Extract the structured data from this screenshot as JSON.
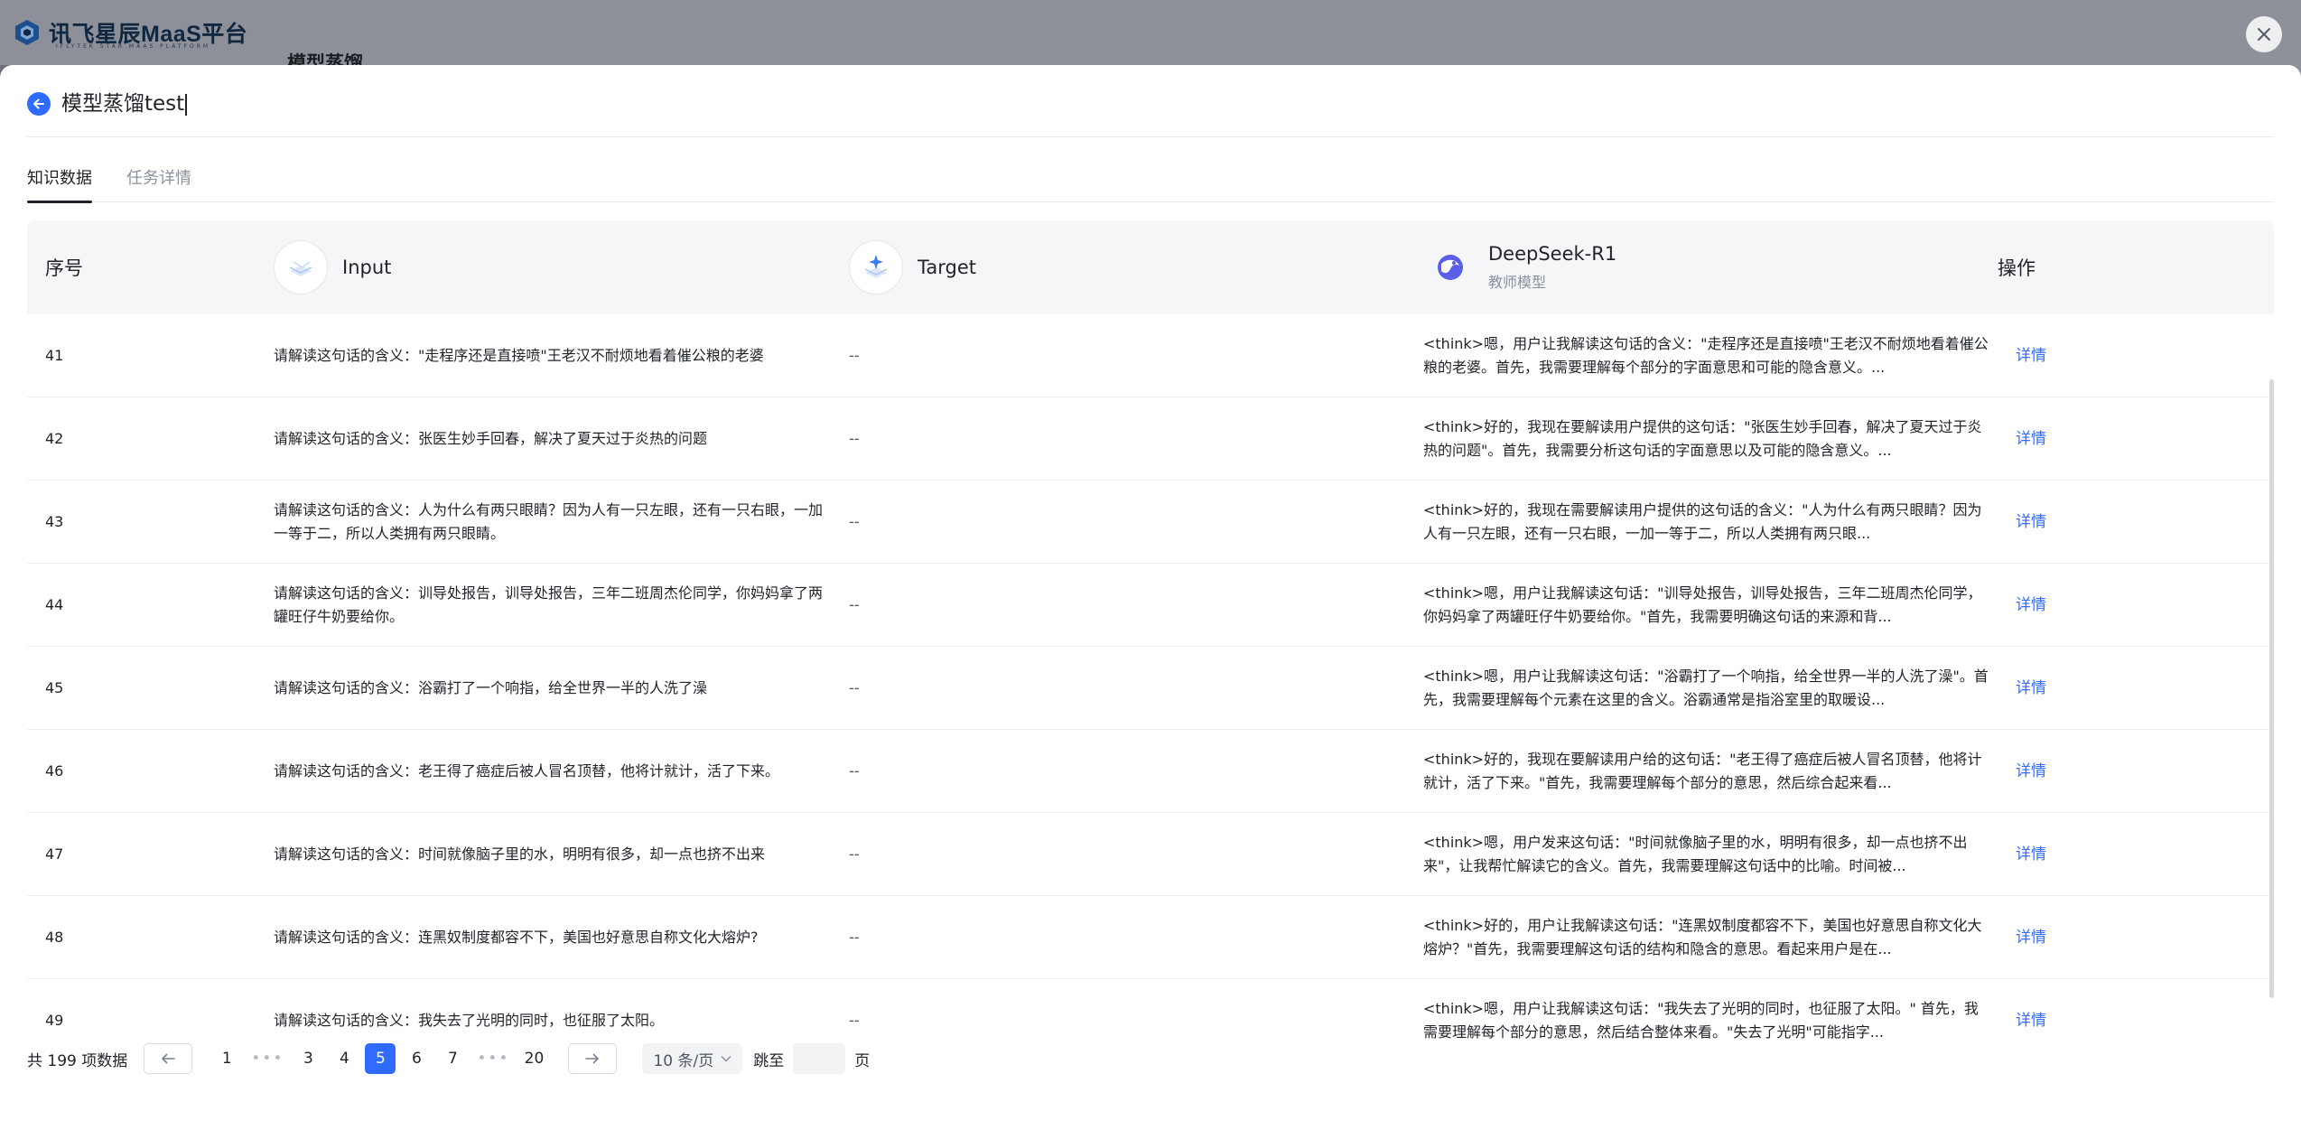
{
  "app": {
    "logo_text": "讯飞星辰MaaS平台",
    "logo_sub": "IFLYTEK STAR MAAS PLATFORM",
    "bg_page_title": "模型蒸馏"
  },
  "drawer": {
    "title": "模型蒸馏test",
    "tabs": [
      {
        "label": "知识数据",
        "active": true
      },
      {
        "label": "任务详情",
        "active": false
      }
    ]
  },
  "table": {
    "headers": {
      "no": "序号",
      "input": "Input",
      "target": "Target",
      "teacher_name": "DeepSeek-R1",
      "teacher_sub": "教师模型",
      "op": "操作"
    },
    "action_label": "详情",
    "rows": [
      {
        "no": "41",
        "input": "请解读这句话的含义：\"走程序还是直接喷\"王老汉不耐烦地看着催公粮的老婆",
        "target": "--",
        "output": "<think>嗯，用户让我解读这句话的含义：\"走程序还是直接喷\"王老汉不耐烦地看着催公粮的老婆。首先，我需要理解每个部分的字面意思和可能的隐含意义。..."
      },
      {
        "no": "42",
        "input": "请解读这句话的含义：张医生妙手回春，解决了夏天过于炎热的问题",
        "target": "--",
        "output": "<think>好的，我现在要解读用户提供的这句话：\"张医生妙手回春，解决了夏天过于炎热的问题\"。首先，我需要分析这句话的字面意思以及可能的隐含意义。..."
      },
      {
        "no": "43",
        "input": "请解读这句话的含义：人为什么有两只眼睛？因为人有一只左眼，还有一只右眼，一加一等于二，所以人类拥有两只眼睛。",
        "target": "--",
        "output": "<think>好的，我现在需要解读用户提供的这句话的含义：\"人为什么有两只眼睛？因为人有一只左眼，还有一只右眼，一加一等于二，所以人类拥有两只眼..."
      },
      {
        "no": "44",
        "input": "请解读这句话的含义：训导处报告，训导处报告，三年二班周杰伦同学，你妈妈拿了两罐旺仔牛奶要给你。",
        "target": "--",
        "output": "<think>嗯，用户让我解读这句话：\"训导处报告，训导处报告，三年二班周杰伦同学，你妈妈拿了两罐旺仔牛奶要给你。\"首先，我需要明确这句话的来源和背..."
      },
      {
        "no": "45",
        "input": "请解读这句话的含义：浴霸打了一个响指，给全世界一半的人洗了澡",
        "target": "--",
        "output": "<think>嗯，用户让我解读这句话：\"浴霸打了一个响指，给全世界一半的人洗了澡\"。首先，我需要理解每个元素在这里的含义。浴霸通常是指浴室里的取暖设..."
      },
      {
        "no": "46",
        "input": "请解读这句话的含义：老王得了癌症后被人冒名顶替，他将计就计，活了下来。",
        "target": "--",
        "output": "<think>好的，我现在要解读用户给的这句话：\"老王得了癌症后被人冒名顶替，他将计就计，活了下来。\"首先，我需要理解每个部分的意思，然后综合起来看..."
      },
      {
        "no": "47",
        "input": "请解读这句话的含义：时间就像脑子里的水，明明有很多，却一点也挤不出来",
        "target": "--",
        "output": "<think>嗯，用户发来这句话：\"时间就像脑子里的水，明明有很多，却一点也挤不出来\"，让我帮忙解读它的含义。首先，我需要理解这句话中的比喻。时间被..."
      },
      {
        "no": "48",
        "input": "请解读这句话的含义：连黑奴制度都容不下，美国也好意思自称文化大熔炉?",
        "target": "--",
        "output": "<think>好的，用户让我解读这句话：\"连黑奴制度都容不下，美国也好意思自称文化大熔炉？\"首先，我需要理解这句话的结构和隐含的意思。看起来用户是在..."
      },
      {
        "no": "49",
        "input": "请解读这句话的含义：我失去了光明的同时，也征服了太阳。",
        "target": "--",
        "output": "<think>嗯，用户让我解读这句话：\"我失去了光明的同时，也征服了太阳。\" 首先，我需要理解每个部分的意思，然后结合整体来看。\"失去了光明\"可能指字..."
      }
    ]
  },
  "pagination": {
    "total_text": "共 199 项数据",
    "pages": [
      "1",
      "3",
      "4",
      "5",
      "6",
      "7",
      "20"
    ],
    "current": "5",
    "ellipsis": "•••",
    "page_size": "10 条/页",
    "jump_label": "跳至",
    "jump_value": "",
    "page_suffix": "页"
  },
  "colors": {
    "accent": "#2f6bff",
    "link": "#2f6bff"
  }
}
